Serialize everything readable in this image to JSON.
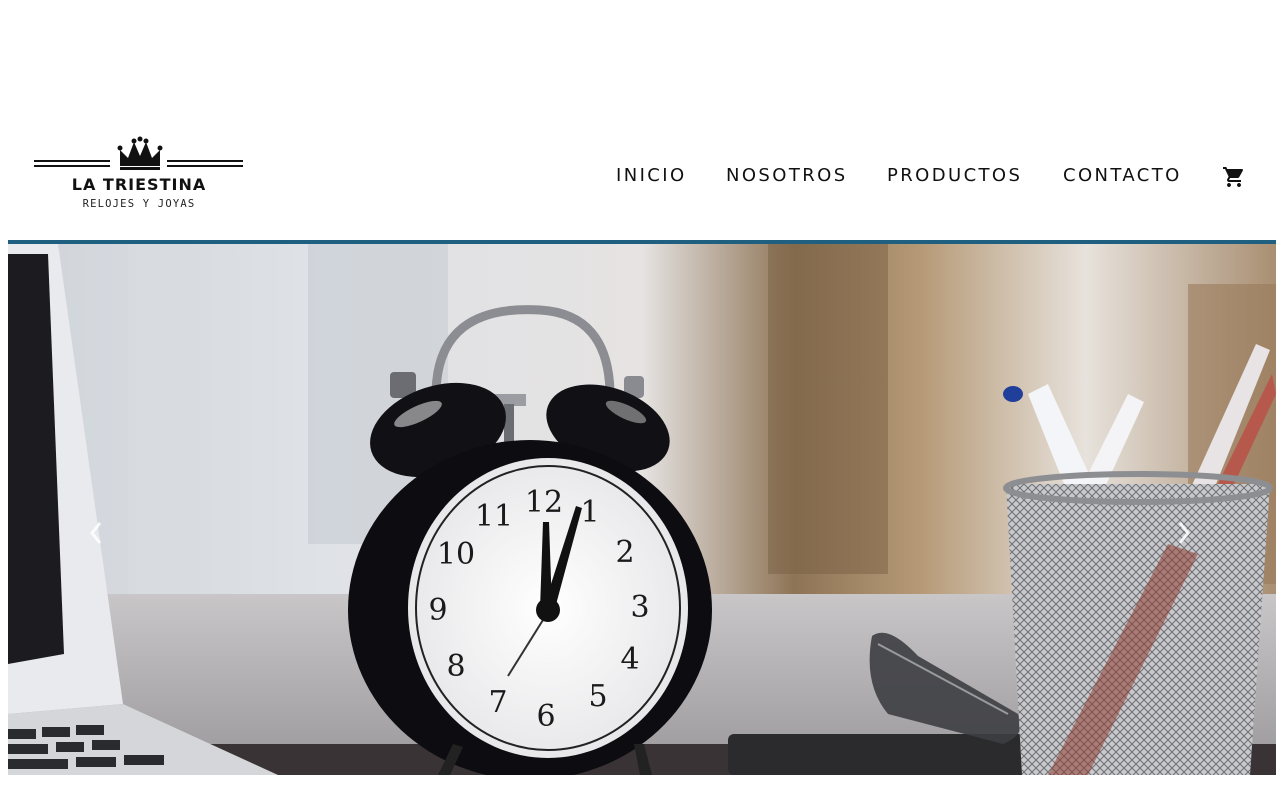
{
  "brand": {
    "name": "LA TRIESTINA",
    "tagline": "RELOJES Y JOYAS"
  },
  "nav": {
    "items": [
      {
        "label": "INICIO"
      },
      {
        "label": "NOSOTROS"
      },
      {
        "label": "PRODUCTOS"
      },
      {
        "label": "CONTACTO"
      }
    ],
    "cart_icon": "shopping-cart-icon"
  },
  "hero": {
    "image": "alarm-clock-desk-photo",
    "prev_icon": "chevron-left-icon",
    "next_icon": "chevron-right-icon"
  },
  "colors": {
    "accent": "#1f5f80",
    "text": "#111111",
    "background": "#ffffff"
  }
}
